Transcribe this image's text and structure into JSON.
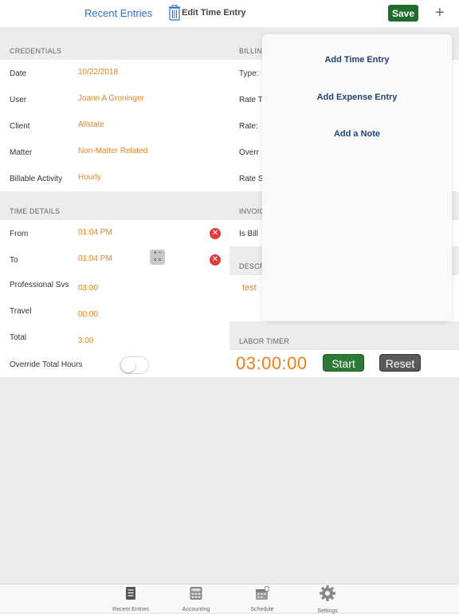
{
  "nav": {
    "back_label": "Recent Entries",
    "title": "Edit Time Entry",
    "save_label": "Save",
    "add_icon": "plus-icon",
    "delete_icon": "trash-icon"
  },
  "credentials": {
    "header": "CREDENTIALS",
    "rows": [
      {
        "label": "Date",
        "value": "10/22/2018"
      },
      {
        "label": "User",
        "value": "Joann A Groninger"
      },
      {
        "label": "Client",
        "value": "Allstate"
      },
      {
        "label": "Matter",
        "value": "Non-Matter Related"
      },
      {
        "label": "Billable Activity",
        "value": "Hourly"
      }
    ]
  },
  "time_details": {
    "header": "TIME DETAILS",
    "from_label": "From",
    "from_value": "01:04 PM",
    "to_label": "To",
    "to_value": "01:04 PM",
    "prof_label": "Professional Svs",
    "prof_value": "03:00",
    "travel_label": "Travel",
    "travel_value": "00:00",
    "total_label": "Total",
    "total_value": "3.00",
    "override_label": "Override Total Hours",
    "override_on": false
  },
  "billing": {
    "header": "BILLIN",
    "type_label": "Type:",
    "rate_type_label": "Rate T",
    "rate_label": "Rate:",
    "overr_label": "Overr",
    "rate_s_label": "Rate S"
  },
  "invoice": {
    "header": "INVOIC",
    "is_billable_label": "Is Bill"
  },
  "description": {
    "header": "DESCR",
    "value": "test"
  },
  "labor_timer": {
    "header": "LABOR TIMER",
    "time": "03:00:00",
    "start_label": "Start",
    "reset_label": "Reset"
  },
  "menu": {
    "items": [
      "Add Time Entry",
      "Add Expense Entry",
      "Add a Note"
    ]
  },
  "tabbar": {
    "items": [
      {
        "label": "Recent Entries",
        "icon": "list-icon"
      },
      {
        "label": "Accounting",
        "icon": "calculator-icon"
      },
      {
        "label": "Schedule",
        "icon": "calendar-icon"
      },
      {
        "label": "Settings",
        "icon": "gear-icon"
      }
    ]
  },
  "colors": {
    "accent": "#e5821f",
    "link": "#2f6fc7",
    "save": "#1f6d2e",
    "delete": "#e13b3b"
  }
}
